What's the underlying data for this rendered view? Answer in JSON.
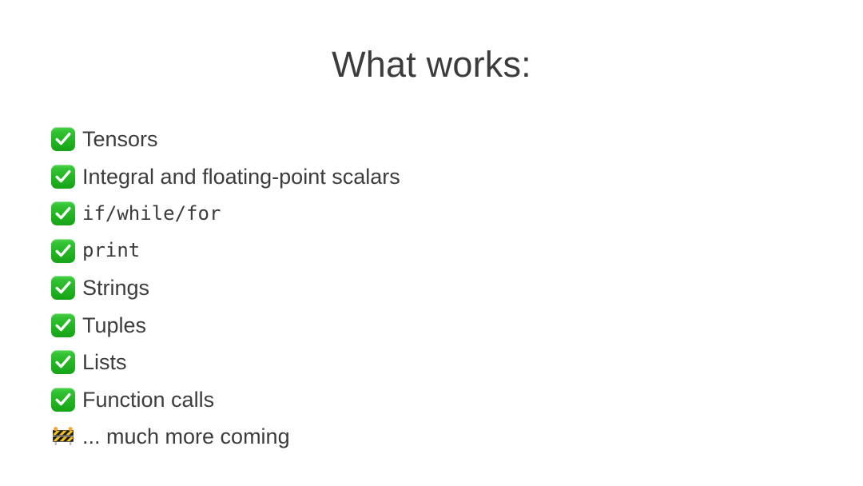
{
  "slide": {
    "title": "What works:",
    "background_color": "#ffffff",
    "text_color": "#3c3c3c",
    "accent_color": "#22b522",
    "items": [
      {
        "icon": "check-mark-button-icon",
        "label": "Tensors",
        "mono": false
      },
      {
        "icon": "check-mark-button-icon",
        "label": "Integral and floating-point scalars",
        "mono": false
      },
      {
        "icon": "check-mark-button-icon",
        "label": "if/while/for",
        "mono": true
      },
      {
        "icon": "check-mark-button-icon",
        "label": "print",
        "mono": true
      },
      {
        "icon": "check-mark-button-icon",
        "label": "Strings",
        "mono": false
      },
      {
        "icon": "check-mark-button-icon",
        "label": "Tuples",
        "mono": false
      },
      {
        "icon": "check-mark-button-icon",
        "label": "Lists",
        "mono": false
      },
      {
        "icon": "check-mark-button-icon",
        "label": "Function calls",
        "mono": false
      },
      {
        "icon": "construction-icon",
        "label": "... much more coming",
        "mono": false
      }
    ]
  }
}
